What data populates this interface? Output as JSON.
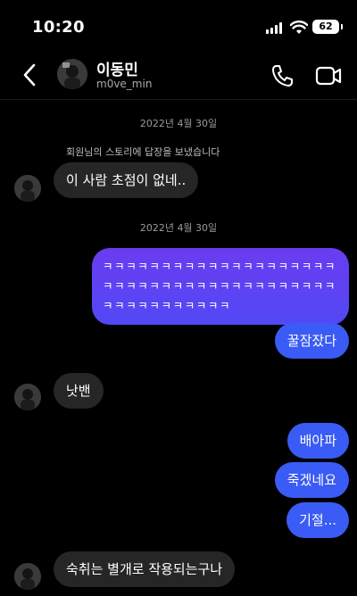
{
  "status_bar": {
    "time": "10:20",
    "battery": "62"
  },
  "header": {
    "name": "이동민",
    "username": "m0ve_min"
  },
  "messages": {
    "date1": "2022년 4월 30일",
    "story_reply_note": "회원님의 스토리에 답장을 보냈습니다",
    "m1": "이 사람 초점이 없네..",
    "date2": "2022년 4월 30일",
    "m2": "ㅋㅋㅋㅋㅋㅋㅋㅋㅋㅋㅋㅋㅋㅋㅋㅋㅋㅋㅋㅋㅋㅋㅋㅋㅋㅋㅋㅋㅋㅋㅋㅋㅋㅋㅋㅋㅋㅋㅋㅋㅋㅋㅋㅋㅋㅋㅋㅋㅋㅋㅋ",
    "m3": "꿀잠잤다",
    "m4": "낫밴",
    "m5": "배아파",
    "m6": "죽겠네요",
    "m7": "기절...",
    "m8": "숙취는 별개로 작용되는구나"
  },
  "colors": {
    "outgoing": "#3a5bf5",
    "incoming": "#262626",
    "gradient_start": "#6a3cf0"
  },
  "icons": [
    "back-icon",
    "phone-icon",
    "video-icon",
    "signal-icon",
    "wifi-icon",
    "battery-icon"
  ]
}
